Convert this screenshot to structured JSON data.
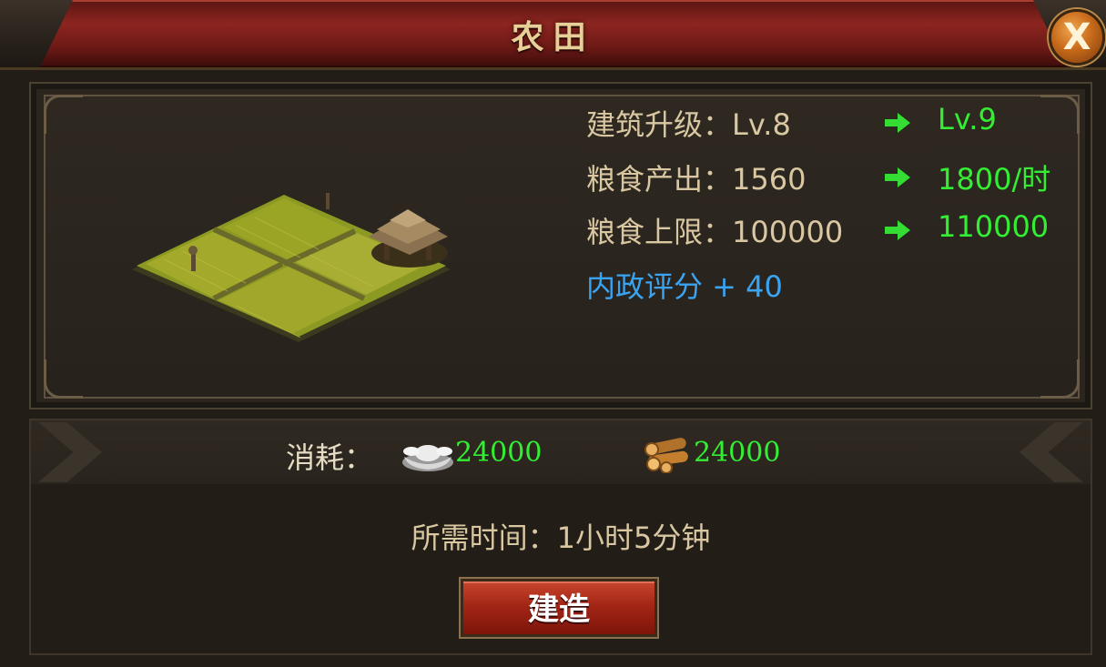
{
  "window": {
    "title": "农田"
  },
  "close": {
    "label": "X"
  },
  "stats": [
    {
      "label": "建筑升级：",
      "current": "Lv.8",
      "next": "Lv.9"
    },
    {
      "label": "粮食产出：",
      "current": "1560",
      "next": "1800/时"
    },
    {
      "label": "粮食上限：",
      "current": "100000",
      "next": "110000"
    }
  ],
  "score": {
    "text": "内政评分 + 40"
  },
  "cost": {
    "label": "消耗：",
    "silver": {
      "icon": "silver-ingot-icon",
      "value": "24000"
    },
    "wood": {
      "icon": "wood-logs-icon",
      "value": "24000"
    }
  },
  "time": {
    "text": "所需时间：1小时5分钟"
  },
  "build_button": {
    "label": "建造"
  },
  "colors": {
    "increase": "#33ee33",
    "score": "#3aa3f2",
    "title": "#e7cf98"
  }
}
